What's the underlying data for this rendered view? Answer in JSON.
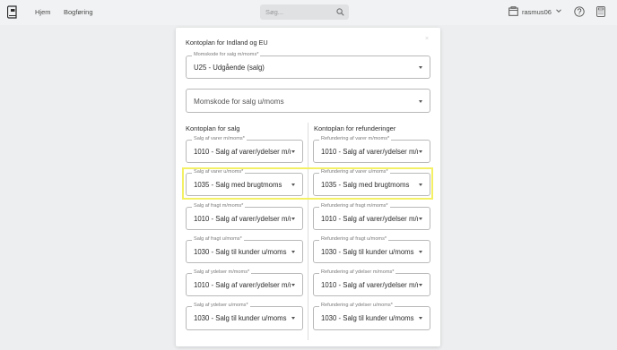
{
  "nav": {
    "logo_icon": "book-icon",
    "links": [
      "Hjem",
      "Bogføring"
    ]
  },
  "search": {
    "placeholder": "Søg...",
    "icon": "search-icon"
  },
  "user": {
    "name": "rasmus06",
    "icon": "building-icon"
  },
  "icons": {
    "help": "help-circle-icon",
    "calculator": "calculator-icon"
  },
  "dialog": {
    "title": "Kontoplan for Indland og EU",
    "close": "×",
    "momskode_salg_mmoms": {
      "label": "Momskode for salg m/moms*",
      "value": "U25 - Udgående (salg)"
    },
    "momskode_salg_umoms": {
      "placeholder": "Momskode for salg u/moms"
    },
    "col_salg_title": "Kontoplan for salg",
    "col_refund_title": "Kontoplan for refunderinger",
    "rows": [
      {
        "salg": {
          "label": "Salg af varer m/moms*",
          "value": "1010 - Salg af varer/ydelser m/moms"
        },
        "refund": {
          "label": "Refundering af varer m/moms*",
          "value": "1010 - Salg af varer/ydelser m/moms"
        }
      },
      {
        "salg": {
          "label": "Salg af varer u/moms*",
          "value": "1035 - Salg med brugtmoms"
        },
        "refund": {
          "label": "Refundering af varer u/moms*",
          "value": "1035 - Salg med brugtmoms"
        }
      },
      {
        "salg": {
          "label": "Salg af fragt m/moms*",
          "value": "1010 - Salg af varer/ydelser m/moms"
        },
        "refund": {
          "label": "Refundering af fragt m/moms*",
          "value": "1010 - Salg af varer/ydelser m/moms"
        }
      },
      {
        "salg": {
          "label": "Salg af fragt u/moms*",
          "value": "1030 - Salg til kunder u/moms"
        },
        "refund": {
          "label": "Refundering af fragt u/moms*",
          "value": "1030 - Salg til kunder u/moms"
        }
      },
      {
        "salg": {
          "label": "Salg af ydelser m/moms*",
          "value": "1010 - Salg af varer/ydelser m/moms"
        },
        "refund": {
          "label": "Refundering af ydelser m/moms*",
          "value": "1010 - Salg af varer/ydelser m/moms"
        }
      },
      {
        "salg": {
          "label": "Salg af ydelser u/moms*",
          "value": "1030 - Salg til kunder u/moms"
        },
        "refund": {
          "label": "Refundering af ydelser u/moms*",
          "value": "1030 - Salg til kunder u/moms"
        }
      }
    ]
  },
  "colors": {
    "background": "#eceeef",
    "highlight": "#f4f066",
    "border": "#b9b9b9"
  }
}
